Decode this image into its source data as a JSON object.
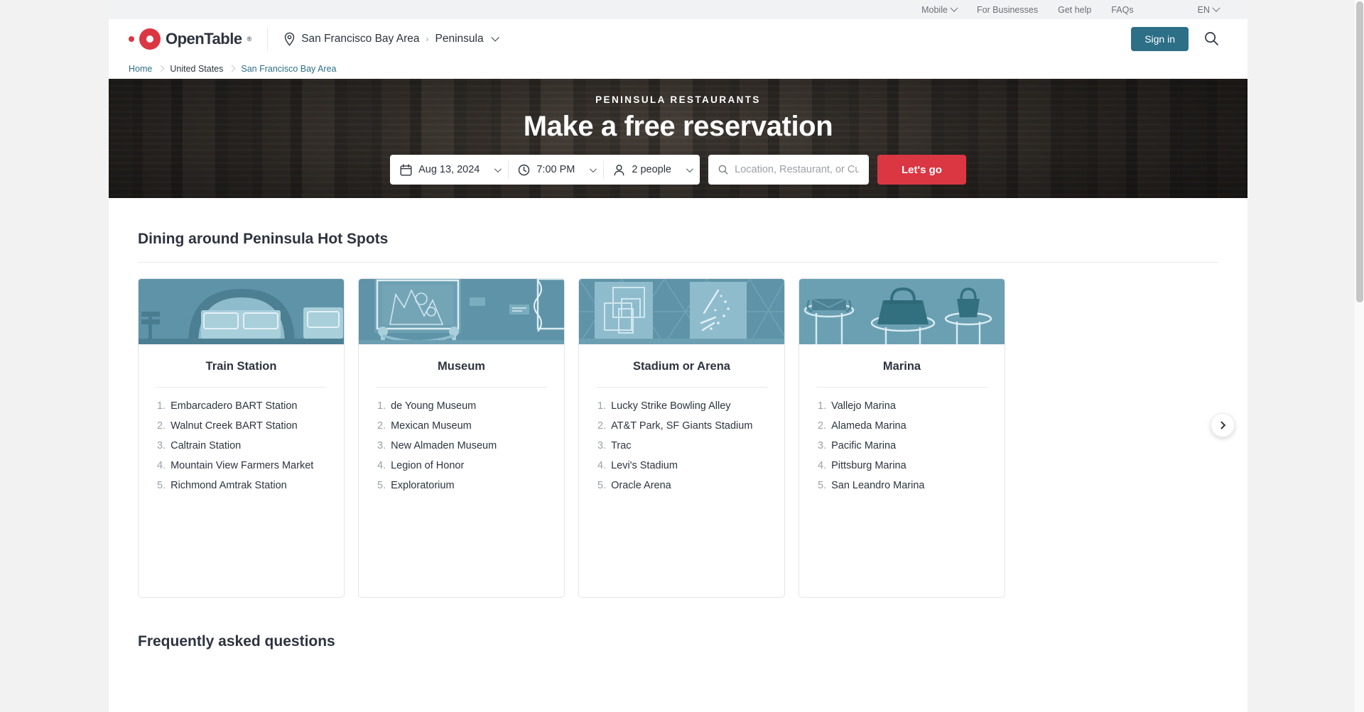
{
  "utility_bar": {
    "items": [
      {
        "label": "Mobile",
        "icon": "chevron-down-icon",
        "has_caret": true
      },
      {
        "label": "For Businesses",
        "has_caret": false
      },
      {
        "label": "Get help",
        "has_caret": false
      },
      {
        "label": "FAQs",
        "has_caret": false
      },
      {
        "label": "EN",
        "icon": "chevron-down-icon",
        "has_caret": true
      }
    ]
  },
  "header": {
    "brand": "OpenTable",
    "brand_mark": "registered-trademark",
    "location": {
      "icon": "location-pin-icon",
      "region": "San Francisco Bay Area",
      "separator": "›",
      "sub_region": "Peninsula",
      "caret_icon": "chevron-down-icon"
    },
    "sign_in_label": "Sign in",
    "search_icon": "search-icon"
  },
  "breadcrumb": {
    "items": [
      {
        "label": "Home",
        "type": "link"
      },
      {
        "label": "United States",
        "type": "static"
      },
      {
        "label": "San Francisco Bay Area",
        "type": "link"
      }
    ]
  },
  "hero": {
    "kicker": "PENINSULA RESTAURANTS",
    "title": "Make a free reservation",
    "search": {
      "date": {
        "icon": "calendar-icon",
        "value": "Aug 13, 2024"
      },
      "time": {
        "icon": "clock-icon",
        "value": "7:00 PM"
      },
      "party": {
        "icon": "person-icon",
        "value": "2 people"
      },
      "query": {
        "icon": "search-icon",
        "value": "",
        "placeholder": "Location, Restaurant, or Cuisine"
      },
      "submit_label": "Let's go"
    }
  },
  "main": {
    "section_title": "Dining around Peninsula Hot Spots",
    "carousel": {
      "next_icon": "chevron-right-icon",
      "cards": [
        {
          "title": "Train Station",
          "image": "train-station-illustration",
          "items": [
            "Embarcadero BART Station",
            "Walnut Creek BART Station",
            "Caltrain Station",
            "Mountain View Farmers Market",
            "Richmond Amtrak Station"
          ]
        },
        {
          "title": "Museum",
          "image": "museum-illustration",
          "items": [
            "de Young Museum",
            "Mexican Museum",
            "New Almaden Museum",
            "Legion of Honor",
            "Exploratorium"
          ]
        },
        {
          "title": "Stadium or Arena",
          "image": "stadium-illustration",
          "items": [
            "Lucky Strike Bowling Alley",
            "AT&T Park, SF Giants Stadium",
            "Trac",
            "Levi's Stadium",
            "Oracle Arena"
          ]
        },
        {
          "title": "Marina",
          "image": "marina-illustration",
          "items": [
            "Vallejo Marina",
            "Alameda Marina",
            "Pacific Marina",
            "Pittsburg Marina",
            "San Leandro Marina"
          ]
        }
      ]
    },
    "faq_title": "Frequently asked questions"
  },
  "colors": {
    "brand_red": "#da3743",
    "accent_teal": "#2c6f86",
    "text_dark": "#2d333f",
    "text_muted": "#6b6f76",
    "illustration_blue": "#5b93a8"
  }
}
